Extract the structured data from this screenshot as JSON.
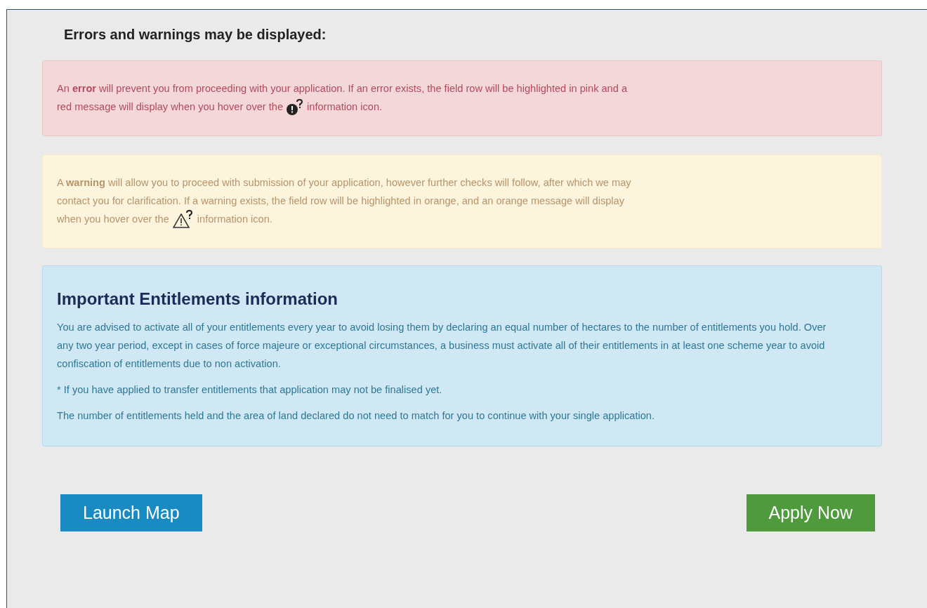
{
  "heading": "Errors and warnings may be displayed:",
  "alerts": [
    {
      "kind": "error",
      "lines": [
        "An **error** will prevent you from proceeding with your application. If an error exists, the field row will be highlighted in pink and a"
      ],
      "last_line_before_icon": "red message will display when you hover over the",
      "last_line_after_icon": "information icon."
    },
    {
      "kind": "warning",
      "lines": [
        "A **warning** will allow you to proceed with submission of your application, however further checks will follow, after which we may",
        "contact you for clarification. If a warning exists, the field row will be highlighted in orange, and an orange message will display"
      ],
      "last_line_before_icon": "when you hover over the",
      "last_line_after_icon": "information icon."
    }
  ],
  "info": {
    "title": "Important Entitlements information",
    "paragraphs": [
      "You are advised to activate all of your entitlements every year to avoid losing them by declaring an equal number of hectares to the number of entitlements you hold. Over any two year period, except in cases of force majeure or exceptional circumstances, a business must activate all of their entitlements in at least one scheme year to avoid confiscation of entitlements due to non activation.",
      "* If you have applied to transfer entitlements that application may not be finalised yet.",
      "The number of entitlements held and the area of land declared do not need to match for you to continue with your single application."
    ]
  },
  "buttons": [
    {
      "kind": "primary",
      "label": "Launch Map"
    },
    {
      "kind": "success",
      "label": "Apply Now"
    }
  ]
}
